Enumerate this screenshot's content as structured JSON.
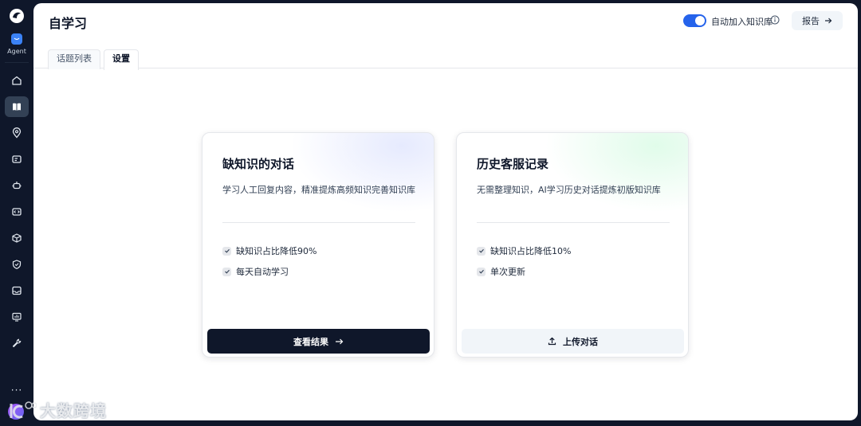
{
  "sidebar": {
    "agent_label": "Agent",
    "more_label": "···",
    "items": [
      {
        "icon": "home-icon",
        "active": false
      },
      {
        "icon": "book-icon",
        "active": true
      },
      {
        "icon": "location-pin-icon",
        "active": false
      },
      {
        "icon": "ticket-icon",
        "active": false
      },
      {
        "icon": "robot-icon",
        "active": false
      },
      {
        "icon": "code-icon",
        "active": false
      },
      {
        "icon": "cube-icon",
        "active": false
      },
      {
        "icon": "shield-icon",
        "active": false
      },
      {
        "icon": "inbox-icon",
        "active": false
      },
      {
        "icon": "analytics-icon",
        "active": false
      },
      {
        "icon": "wrench-icon",
        "active": false
      }
    ]
  },
  "header": {
    "title": "自学习",
    "toggle_label": "自动加入知识库",
    "toggle_on": true,
    "report_label": "报告"
  },
  "tabs": [
    {
      "label": "话题列表",
      "active": false
    },
    {
      "label": "设置",
      "active": true
    }
  ],
  "cards": [
    {
      "title": "缺知识的对话",
      "description": "学习人工回复内容，精准提炼高频知识完善知识库",
      "features": [
        "缺知识占比降低90%",
        "每天自动学习"
      ],
      "button_label": "查看结果"
    },
    {
      "title": "历史客服记录",
      "description": "无需整理知识，AI学习历史对话提炼初版知识库",
      "features": [
        "缺知识占比降低10%",
        "单次更新"
      ],
      "button_label": "上传对话"
    }
  ],
  "watermark": {
    "text": "大数跨境"
  },
  "colors": {
    "sidebar_bg": "#0f172a",
    "accent": "#2563eb",
    "dark_button": "#0f172a"
  }
}
